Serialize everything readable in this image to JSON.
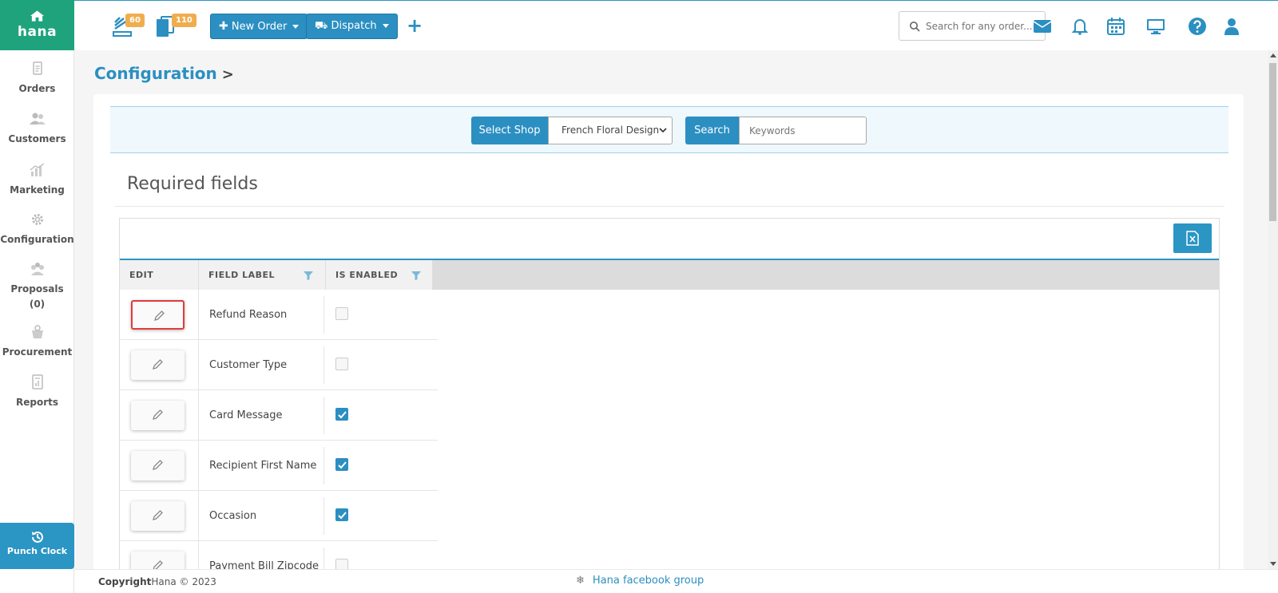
{
  "app": {
    "brand": "hana"
  },
  "sidebar": {
    "items": [
      {
        "label": "Orders",
        "icon": "clipboard-icon"
      },
      {
        "label": "Customers",
        "icon": "users-icon"
      },
      {
        "label": "Marketing",
        "icon": "chart-icon"
      },
      {
        "label": "Configuration",
        "icon": "gear-icon"
      },
      {
        "label": "Proposals",
        "sub": "(0)",
        "icon": "proposals-icon"
      },
      {
        "label": "Procurement",
        "icon": "procurement-icon"
      },
      {
        "label": "Reports",
        "icon": "report-icon"
      }
    ],
    "punch_clock": "Punch Clock"
  },
  "topbar": {
    "badge_orders": "60",
    "badge_tasks": "110",
    "new_order": "New Order",
    "dispatch": "Dispatch",
    "add": "+",
    "search_placeholder": "Search for any order..."
  },
  "breadcrumb": {
    "title": "Configuration",
    "separator": ">"
  },
  "filter": {
    "select_shop_label": "Select Shop",
    "shop_value": "French Floral Design",
    "search_label": "Search",
    "keywords_placeholder": "Keywords"
  },
  "section": {
    "title": "Required fields"
  },
  "grid": {
    "columns": [
      "EDIT",
      "FIELD LABEL",
      "IS ENABLED"
    ],
    "rows": [
      {
        "label": "Refund Reason",
        "enabled": false
      },
      {
        "label": "Customer Type",
        "enabled": false
      },
      {
        "label": "Card Message",
        "enabled": true
      },
      {
        "label": "Recipient First Name",
        "enabled": true
      },
      {
        "label": "Occasion",
        "enabled": true
      },
      {
        "label": "Payment Bill Zipcode",
        "enabled": false
      }
    ]
  },
  "footer": {
    "copyright_bold": "Copyright",
    "copyright_rest": "Hana © 2023",
    "facebook": "Hana facebook group"
  },
  "colors": {
    "brand": "#1fa37c",
    "accent": "#2b8fc2",
    "badge": "#f0ad4e",
    "highlight": "#e03b3b"
  }
}
